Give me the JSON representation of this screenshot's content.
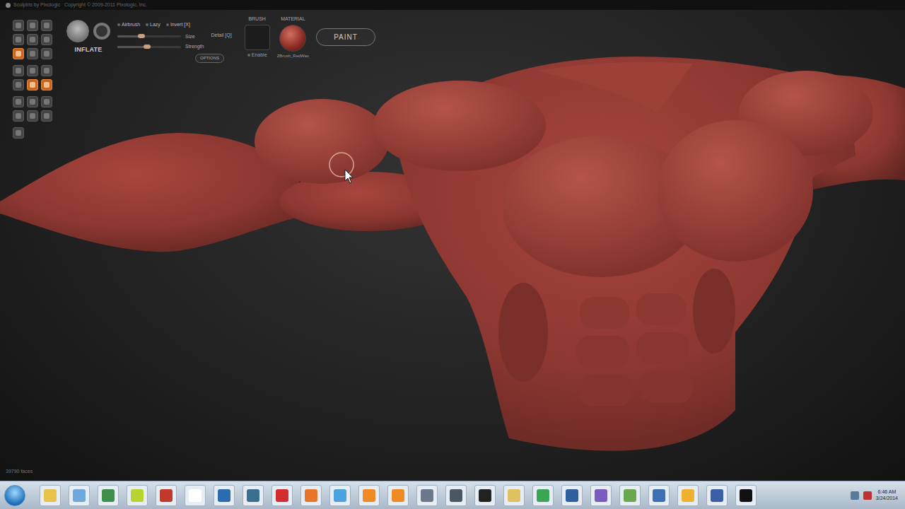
{
  "window": {
    "title": "Sculptris by Pixologic   Copyright © 2009-2011 Pixologic, Inc."
  },
  "tool_groups": [
    {
      "buttons": [
        {
          "selected": false
        },
        {
          "selected": false
        },
        {
          "selected": false
        },
        {
          "selected": false
        },
        {
          "selected": false
        },
        {
          "selected": false
        },
        {
          "selected": true
        },
        {
          "selected": false
        },
        {
          "selected": false
        }
      ]
    },
    {
      "buttons": [
        {
          "selected": false
        },
        {
          "selected": false
        },
        {
          "selected": false
        },
        {
          "selected": false
        },
        {
          "selected": true
        },
        {
          "selected": true
        }
      ]
    },
    {
      "buttons": [
        {
          "selected": false
        },
        {
          "selected": false
        },
        {
          "selected": false
        },
        {
          "selected": false
        },
        {
          "selected": false
        },
        {
          "selected": false
        }
      ]
    },
    {
      "buttons": [
        {
          "selected": false
        }
      ]
    }
  ],
  "brush": {
    "name": "INFLATE",
    "options": [
      {
        "label": "Airbrush",
        "checked": false
      },
      {
        "label": "Lazy",
        "checked": false
      },
      {
        "label": "Invert [X]",
        "checked": false
      }
    ],
    "sliders": [
      {
        "label": "Size",
        "level": 0.38
      },
      {
        "label": "Strength",
        "level": 0.47
      }
    ],
    "detail_label": "Detail [Q]",
    "options_button": "OPTIONS"
  },
  "brush_texture": {
    "label": "BRUSH",
    "enable_label": "Enable",
    "enabled": false
  },
  "material": {
    "label": "MATERIAL",
    "name": "ZBrush_RedWax"
  },
  "paint_button": "PAINT",
  "status": {
    "faces": "39790 faces"
  },
  "taskbar": {
    "apps": [
      {
        "color": "#e8c24a"
      },
      {
        "color": "#6fa8dc"
      },
      {
        "color": "#3d8f4a"
      },
      {
        "color": "#b8d430"
      },
      {
        "color": "#c0392b"
      },
      {
        "color": "#ffffff"
      },
      {
        "color": "#2b6cb0"
      },
      {
        "color": "#3a6f8f"
      },
      {
        "color": "#d22e2e"
      },
      {
        "color": "#e8742a"
      },
      {
        "color": "#4aa3df"
      },
      {
        "color": "#f08a24"
      },
      {
        "color": "#f08a24"
      },
      {
        "color": "#6b7a8a"
      },
      {
        "color": "#4a5866"
      },
      {
        "color": "#222222"
      },
      {
        "color": "#e0c060"
      },
      {
        "color": "#3aa655"
      },
      {
        "color": "#2e5f9e"
      },
      {
        "color": "#7a5cc0"
      },
      {
        "color": "#6aa84f"
      },
      {
        "color": "#3d6fb4"
      },
      {
        "color": "#f0b030"
      },
      {
        "color": "#3a5ea8"
      },
      {
        "color": "#111111"
      }
    ],
    "clock": {
      "time": "6:46 AM",
      "date": "3/24/2014"
    }
  }
}
